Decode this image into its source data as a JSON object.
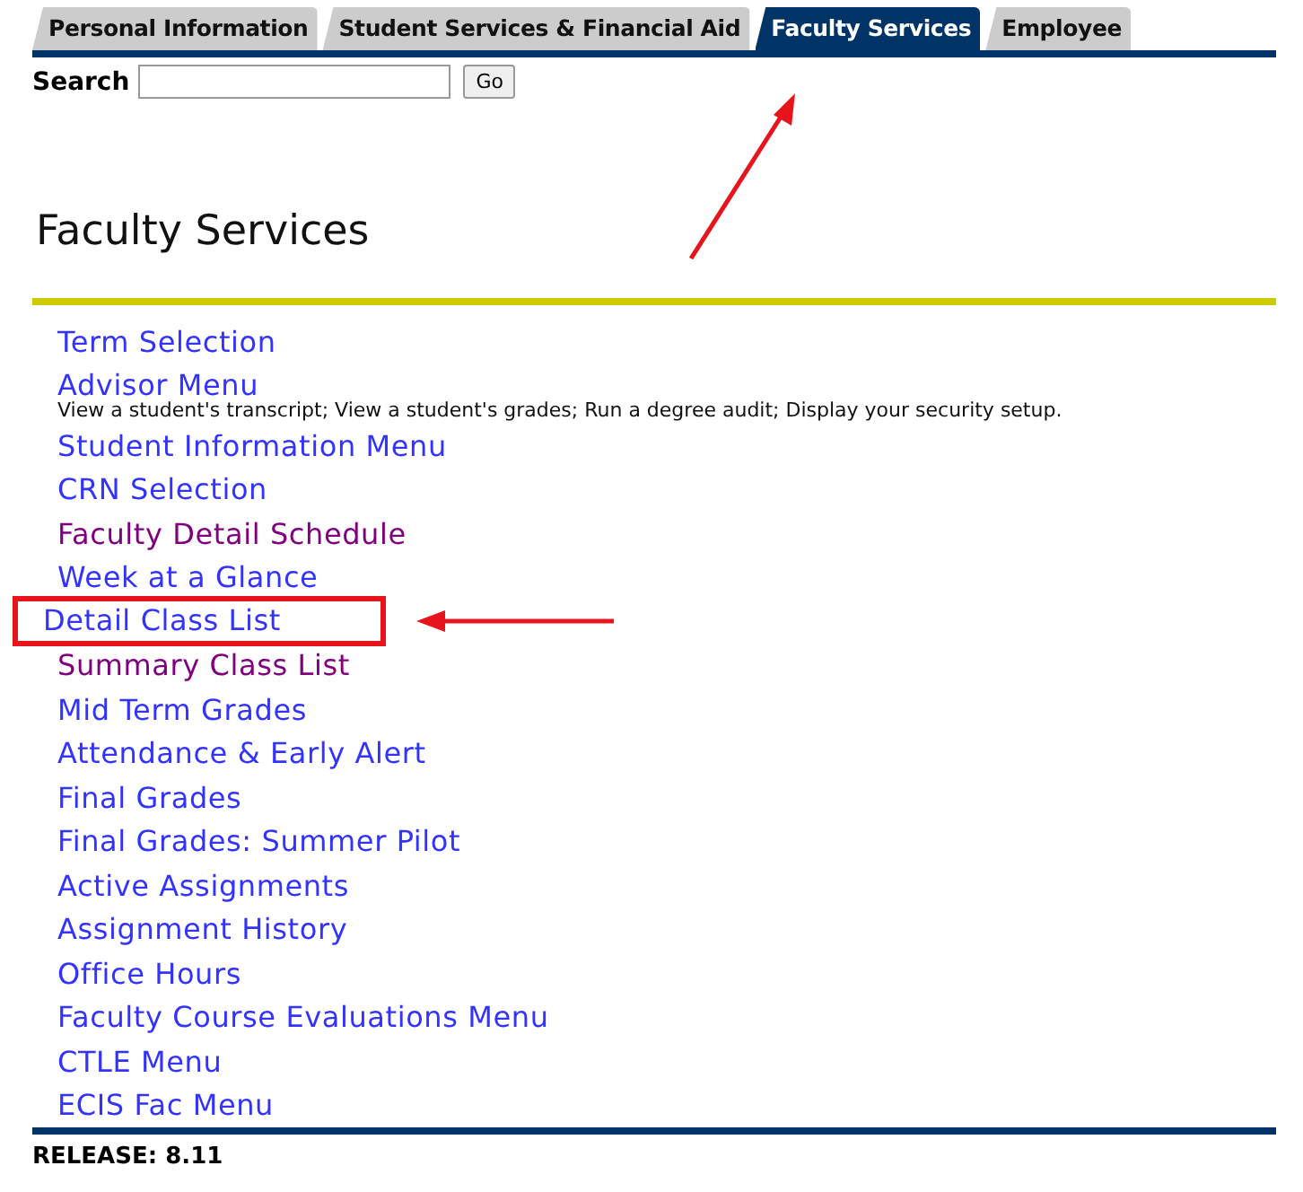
{
  "tabs": [
    {
      "label": "Personal Information",
      "selected": false,
      "pointed": false
    },
    {
      "label": "Student Services & Financial Aid",
      "selected": false,
      "pointed": false
    },
    {
      "label": "Faculty Services",
      "selected": true,
      "pointed": true
    },
    {
      "label": "Employee",
      "selected": false,
      "pointed": false
    }
  ],
  "search": {
    "label": "Search",
    "button": "Go"
  },
  "title": "Faculty Services",
  "menu": [
    {
      "label": "Term Selection",
      "visited": false,
      "highlighted": false
    },
    {
      "label": "Advisor Menu",
      "visited": false,
      "highlighted": false,
      "description": "View a student's transcript; View a student's grades; Run a degree audit; Display your security setup."
    },
    {
      "label": "Student Information Menu",
      "visited": false,
      "highlighted": false
    },
    {
      "label": "CRN Selection",
      "visited": false,
      "highlighted": false
    },
    {
      "label": "Faculty Detail Schedule",
      "visited": true,
      "highlighted": false
    },
    {
      "label": "Week at a Glance",
      "visited": false,
      "highlighted": false
    },
    {
      "label": "Detail Class List",
      "visited": false,
      "highlighted": true
    },
    {
      "label": "Summary Class List",
      "visited": true,
      "highlighted": false
    },
    {
      "label": "Mid Term Grades",
      "visited": false,
      "highlighted": false
    },
    {
      "label": "Attendance & Early Alert",
      "visited": false,
      "highlighted": false
    },
    {
      "label": "Final Grades",
      "visited": false,
      "highlighted": false
    },
    {
      "label": "Final Grades: Summer Pilot",
      "visited": false,
      "highlighted": false
    },
    {
      "label": "Active Assignments",
      "visited": false,
      "highlighted": false
    },
    {
      "label": "Assignment History",
      "visited": false,
      "highlighted": false
    },
    {
      "label": "Office Hours",
      "visited": false,
      "highlighted": false
    },
    {
      "label": "Faculty Course Evaluations Menu",
      "visited": false,
      "highlighted": false
    },
    {
      "label": "CTLE Menu",
      "visited": false,
      "highlighted": false
    },
    {
      "label": "ECIS Fac Menu",
      "visited": false,
      "highlighted": false
    }
  ],
  "release": "RELEASE: 8.11"
}
